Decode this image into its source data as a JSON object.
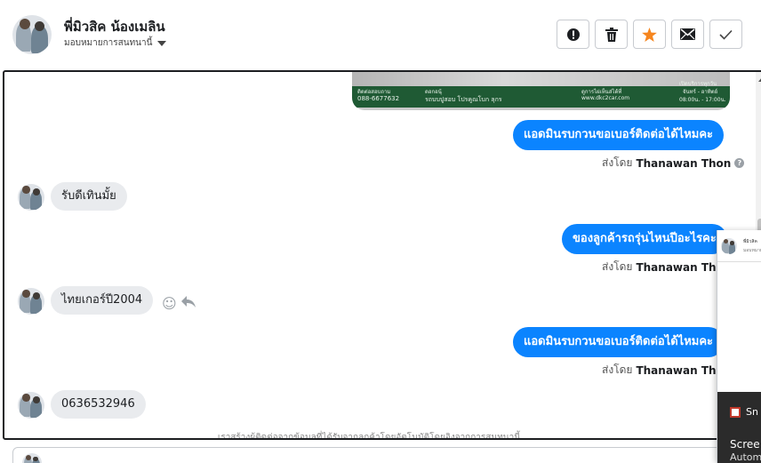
{
  "header": {
    "name": "พี่มิวสิค น้องเมลิน",
    "assign_label": "มอบหมายการสนทนานี้",
    "actions": [
      {
        "icon": "alert-icon",
        "name": "report-button"
      },
      {
        "icon": "trash-icon",
        "name": "delete-button"
      },
      {
        "icon": "star-icon",
        "name": "star-button",
        "color": "#f6861f"
      },
      {
        "icon": "mail-icon",
        "name": "mark-unread-button"
      },
      {
        "icon": "check-icon",
        "name": "mark-done-button"
      }
    ]
  },
  "attachment": {
    "texts": [
      "ติดต่อสอบถาม",
      "088-6677632",
      "ดอกอนุ้",
      "รถบบปูสอบ โปรคูณโบก ลุกร",
      "ดูการไผ่เห็นส่ได้ที่",
      "www.dkc2car.com",
      "เปิดบริการทุกวัน",
      "จันทร์ - อาทิตย์",
      "08:00น. - 17:00น."
    ]
  },
  "messages": [
    {
      "direction": "out",
      "text": "แอดมินรบกวนขอเบอร์ติดต่อได้ไหมคะ",
      "sent_by_label": "ส่งโดย",
      "sender": "Thanawan Thon"
    },
    {
      "direction": "in",
      "text": "รับดีเทินมั้ย"
    },
    {
      "direction": "out",
      "text": "ของลูกค้ารถรุ่นไหนปีอะไรคะ",
      "sent_by_label": "ส่งโดย",
      "sender": "Thanawan Thon"
    },
    {
      "direction": "in",
      "text": "ไทยเกอร์ปี2004"
    },
    {
      "direction": "out",
      "text": "แอดมินรบกวนขอเบอร์ติดต่อได้ไหมคะ",
      "sent_by_label": "ส่งโดย",
      "sender": "Thanawan Thon"
    },
    {
      "direction": "in",
      "text": "0636532946"
    }
  ],
  "footer_note": "เราสร้างผู้ติดต่อจากข้อมูลที่ได้รับจากลูกค้าโดยอัตโนมัติโดยอิงจากการสนทนานี้",
  "popup": {
    "name": "พี่มิวสิค",
    "sub": "มอบหมายการ",
    "task_item": "Sn",
    "task_title": "Scree",
    "task_sub": "Autom"
  },
  "colors": {
    "accent": "#0b84ff",
    "incoming_bubble": "#e9ebee",
    "star": "#f6861f"
  }
}
